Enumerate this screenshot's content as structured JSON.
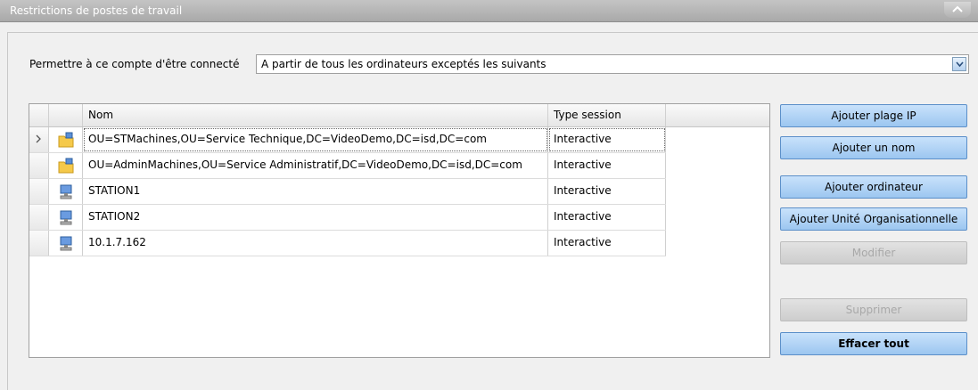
{
  "panel": {
    "title": "Restrictions de postes de travail"
  },
  "permission": {
    "label": "Permettre à ce compte d'être connecté",
    "selected": "A partir de tous les ordinateurs exceptés les suivants"
  },
  "grid": {
    "columns": {
      "name": "Nom",
      "session_type": "Type session"
    },
    "rows": [
      {
        "icon": "ou-folder-icon",
        "name": "OU=STMachines,OU=Service Technique,DC=VideoDemo,DC=isd,DC=com",
        "session_type": "Interactive",
        "current": true
      },
      {
        "icon": "ou-folder-icon",
        "name": "OU=AdminMachines,OU=Service Administratif,DC=VideoDemo,DC=isd,DC=com",
        "session_type": "Interactive",
        "current": false
      },
      {
        "icon": "computer-icon",
        "name": "STATION1",
        "session_type": "Interactive",
        "current": false
      },
      {
        "icon": "computer-icon",
        "name": "STATION2",
        "session_type": "Interactive",
        "current": false
      },
      {
        "icon": "computer-icon",
        "name": "10.1.7.162",
        "session_type": "Interactive",
        "current": false
      }
    ]
  },
  "buttons": {
    "add_ip_range": "Ajouter plage IP",
    "add_name": "Ajouter un nom",
    "add_computer": "Ajouter ordinateur",
    "add_ou": "Ajouter Unité Organisationnelle",
    "modify": "Modifier",
    "delete": "Supprimer",
    "clear_all": "Effacer tout"
  },
  "colors": {
    "button_face": "#b3d4f5",
    "button_border": "#5b8fc9",
    "disabled_face": "#d6d6d6",
    "title_bar": "#b5b5b5"
  }
}
